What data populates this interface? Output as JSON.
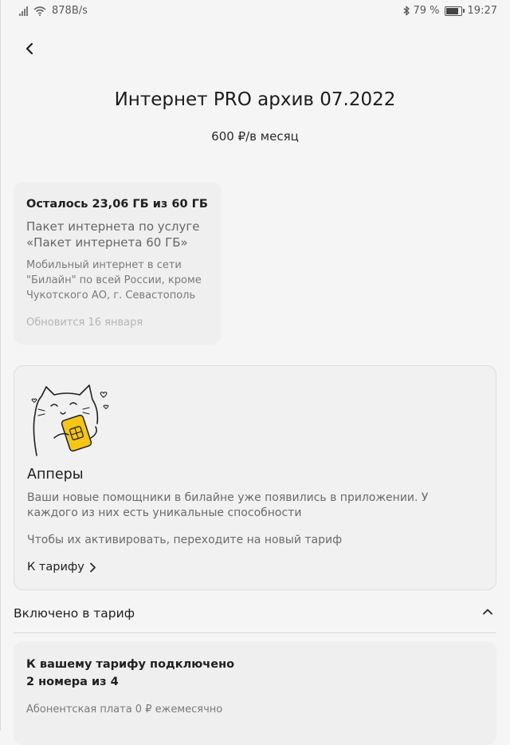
{
  "status_bar": {
    "speed": "878B/s",
    "battery_percent": "79 %",
    "battery_level": 0.79,
    "time": "19:27"
  },
  "header": {
    "title": "Интернет PRO архив 07.2022",
    "price": "600 ₽/в месяц"
  },
  "package": {
    "remaining": "Осталось 23,06 ГБ из 60 ГБ",
    "name": "Пакет интернета по услуге «Пакет интернета 60 ГБ»",
    "description": "Мобильный интернет в сети \"Билайн\" по всей России, кроме Чукотского АО, г. Севастополь и...",
    "renewal": "Обновится 16 января"
  },
  "uppers": {
    "title": "Апперы",
    "description": "Ваши новые помощники в билайне уже появились в приложении. У каждого из них есть уникальные способности",
    "note": "Чтобы их активировать, переходите на новый тариф",
    "link_label": "К тарифу"
  },
  "included": {
    "title": "Включено в тариф",
    "card": {
      "line1": "К вашему тарифу подключено",
      "line2": "2 номера из 4",
      "fee": "Абонентская плата 0 ₽ ежемесячно"
    }
  },
  "icons": {
    "back": "chevron-left-icon",
    "link": "chevron-right-icon",
    "collapse": "chevron-up-icon"
  },
  "colors": {
    "background": "#f5f5f5",
    "card": "#efefef",
    "sim_yellow": "#f5c518"
  }
}
